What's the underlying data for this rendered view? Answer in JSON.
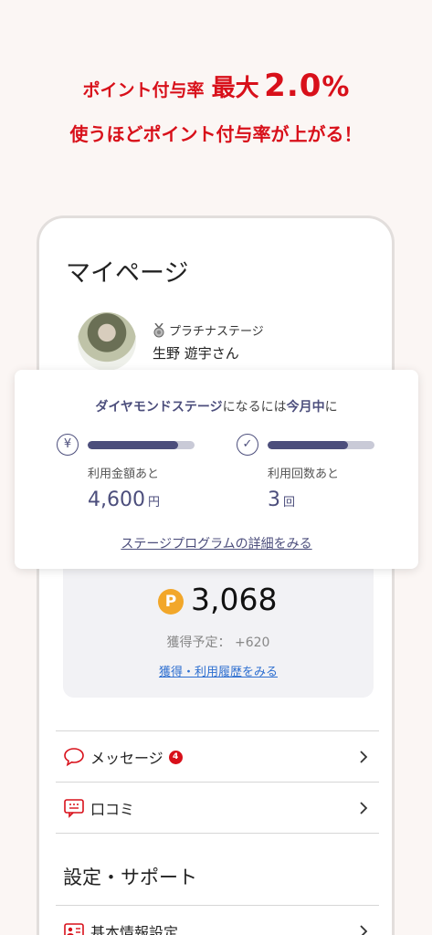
{
  "promo": {
    "line1_prefix": "ポイント付与率",
    "line1_max": "最大",
    "line1_value": "2.0",
    "line1_percent": "%",
    "line2": "使うほどポイント付与率が上がる！"
  },
  "mypage": {
    "title": "マイページ",
    "rank_label": "プラチナステージ",
    "user_name": "生野 遊宇さん"
  },
  "stage_overlay": {
    "heading_part1": "ダイヤモンドステージ",
    "heading_part2": "になるには",
    "heading_part3": "今月中",
    "heading_part4": "に",
    "amount": {
      "icon": "yen-icon",
      "icon_glyph": "¥",
      "label": "利用金額あと",
      "value": "4,600",
      "unit": "円",
      "progress": 0.85
    },
    "count": {
      "icon": "check-icon",
      "icon_glyph": "✓",
      "label": "利用回数あと",
      "value": "3",
      "unit": "回",
      "progress": 0.75
    },
    "details_link": "ステージプログラムの詳細をみる"
  },
  "points": {
    "coin_glyph": "P",
    "value": "3,068",
    "pending_label": "獲得予定：",
    "pending_value": "+620",
    "history_link": "獲得・利用履歴をみる"
  },
  "menu": {
    "items": [
      {
        "label": "メッセージ",
        "badge": "4",
        "icon": "chat-bubble-icon"
      },
      {
        "label": "口コミ",
        "icon": "review-icon"
      }
    ]
  },
  "settings": {
    "title": "設定・サポート",
    "items": [
      {
        "label": "基本情報設定",
        "icon": "id-card-icon"
      }
    ]
  },
  "colors": {
    "brand_red": "#d8101a",
    "accent_navy": "#4c4e7c",
    "link_blue": "#2e6fd0",
    "coin_orange": "#f2a72a"
  }
}
